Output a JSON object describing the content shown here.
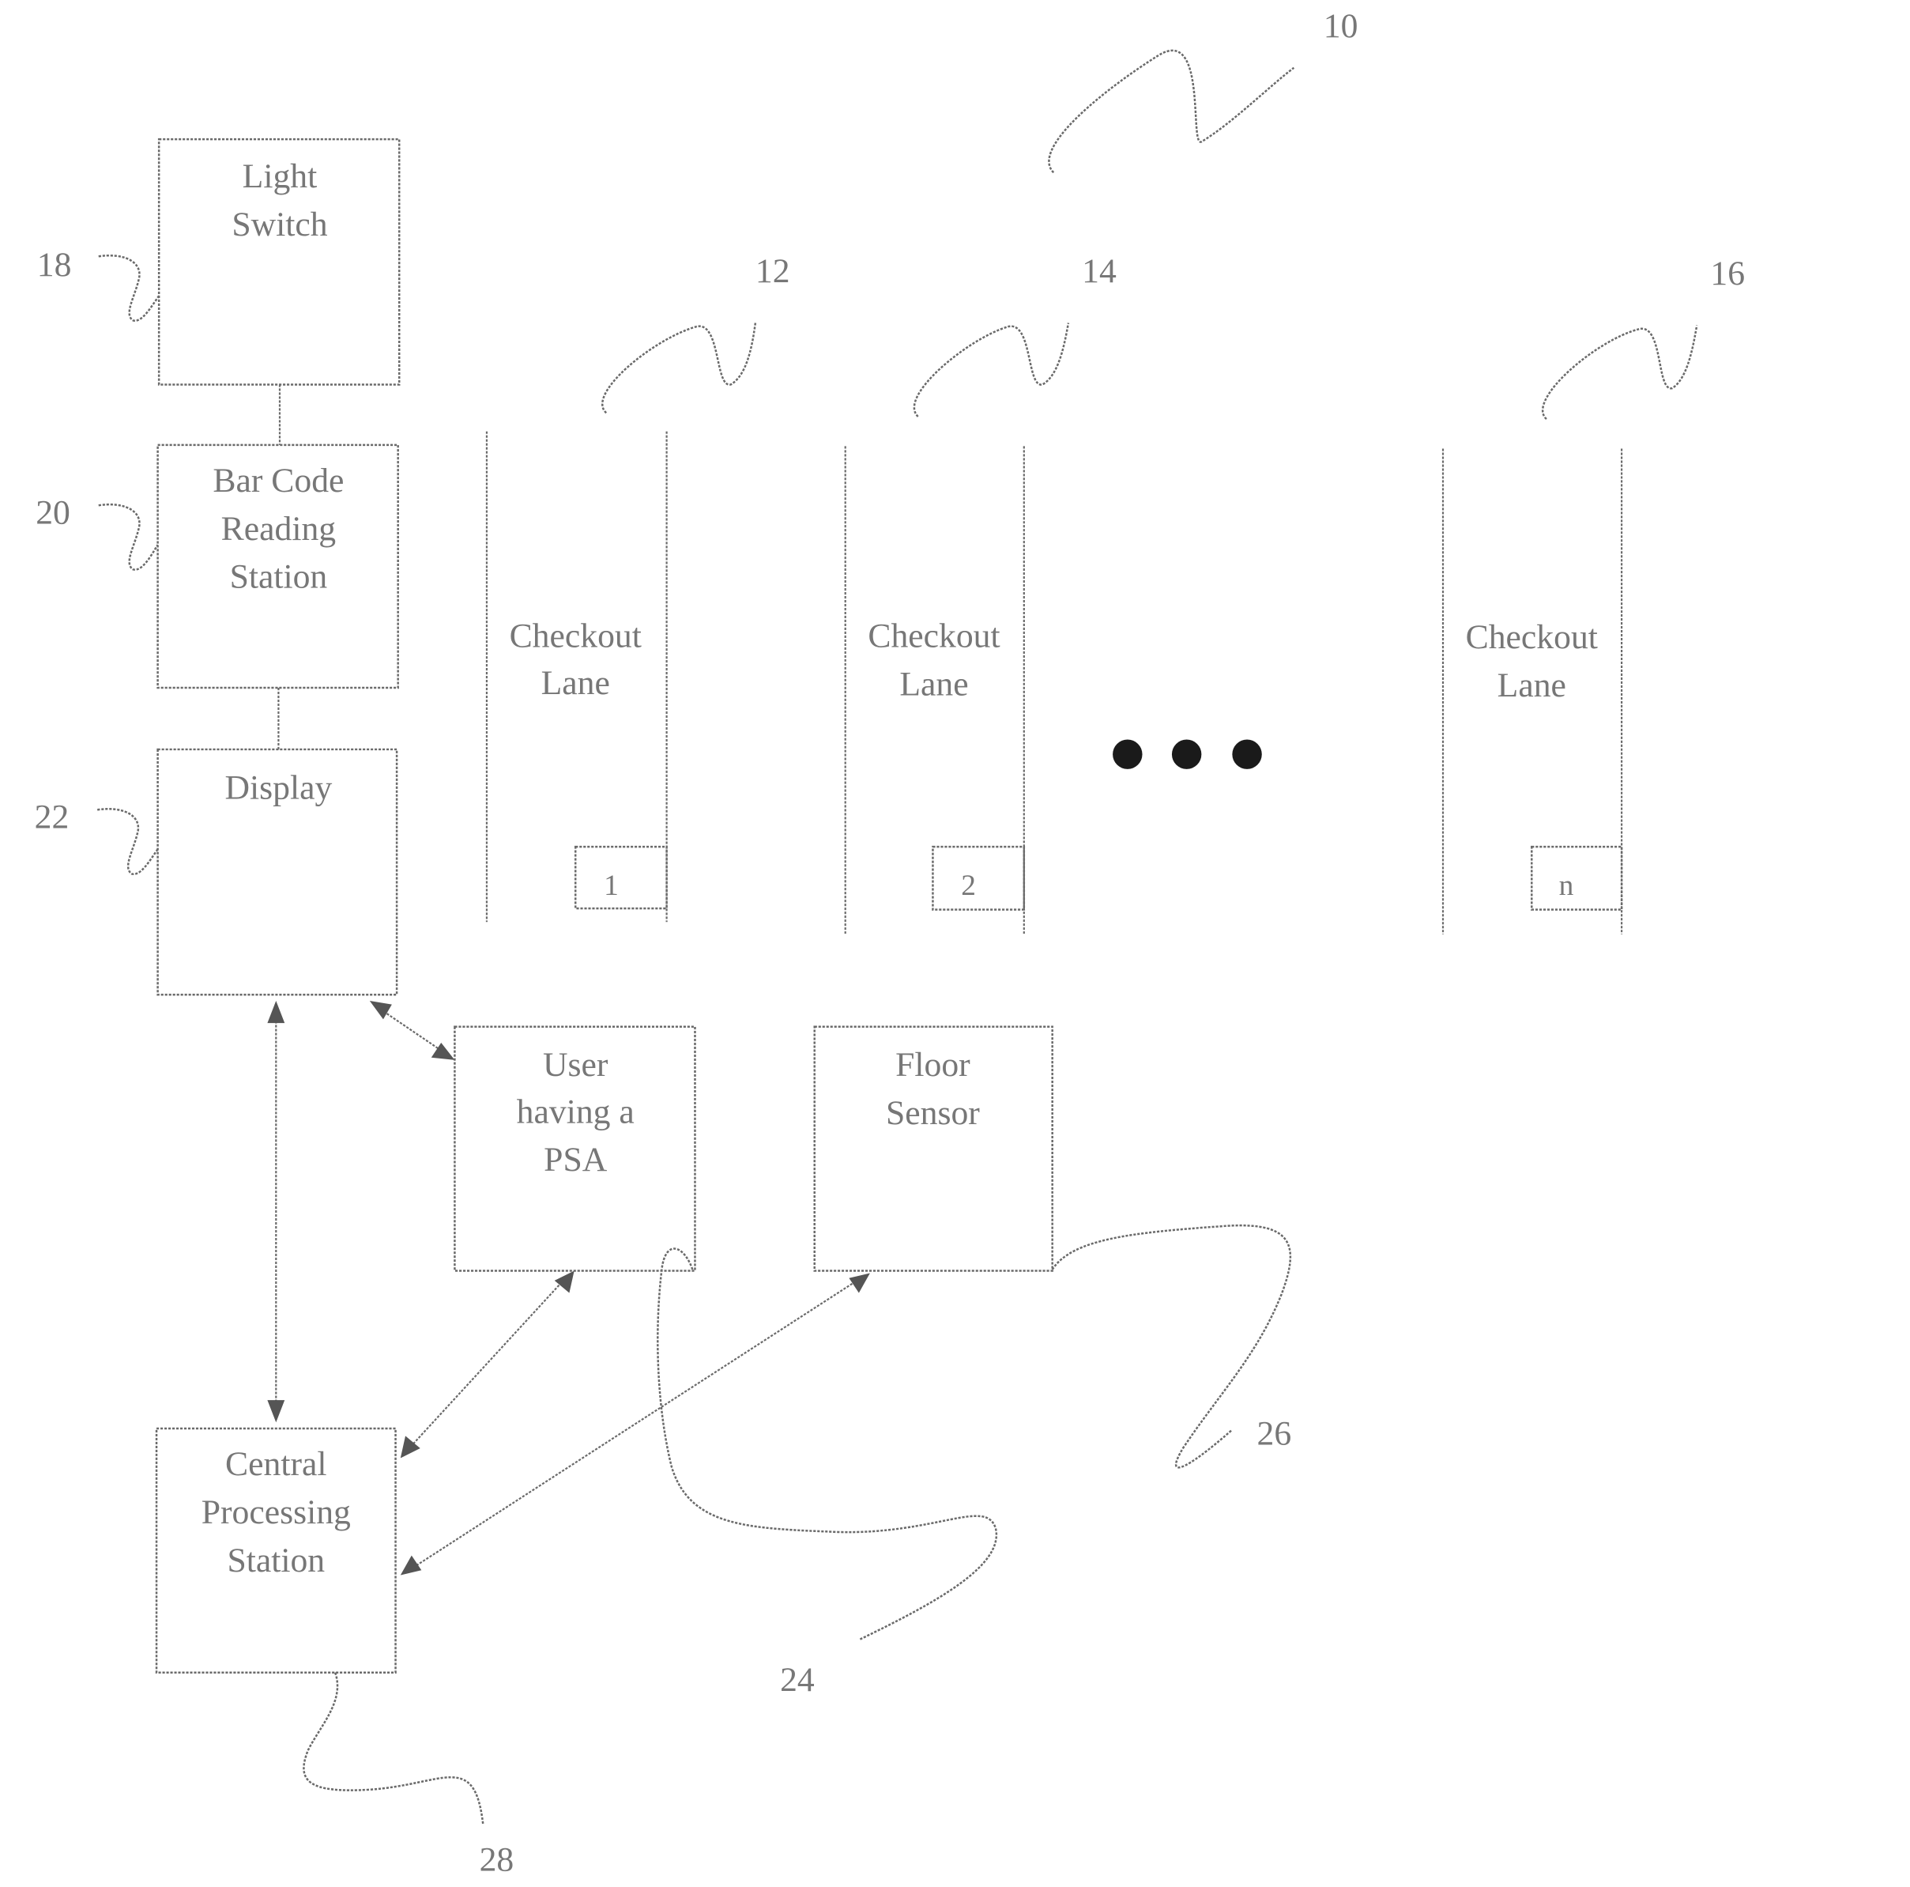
{
  "figure": {
    "reference_numeral": "10",
    "colors": {
      "line": "#6a6a6a",
      "text": "#777777",
      "dots": "#1a1a1a"
    }
  },
  "boxes": {
    "light_switch": {
      "ref": "18",
      "lines": [
        "Light",
        "Switch"
      ]
    },
    "bar_code": {
      "ref": "20",
      "lines": [
        "Bar Code",
        "Reading",
        "Station"
      ]
    },
    "display": {
      "ref": "22",
      "lines": [
        "Display"
      ]
    },
    "user_psa": {
      "ref": "24",
      "lines": [
        "User",
        "having a",
        "PSA"
      ]
    },
    "floor_sensor": {
      "ref": "26",
      "lines": [
        "Floor",
        "Sensor"
      ]
    },
    "central": {
      "ref": "28",
      "lines": [
        "Central",
        "Processing",
        "Station"
      ]
    }
  },
  "lanes": [
    {
      "ref": "12",
      "lines": [
        "Checkout",
        "Lane"
      ],
      "number": "1"
    },
    {
      "ref": "14",
      "lines": [
        "Checkout",
        "Lane"
      ],
      "number": "2"
    },
    {
      "ref": "16",
      "lines": [
        "Checkout",
        "Lane"
      ],
      "number": "n"
    }
  ],
  "ellipsis": "•••"
}
